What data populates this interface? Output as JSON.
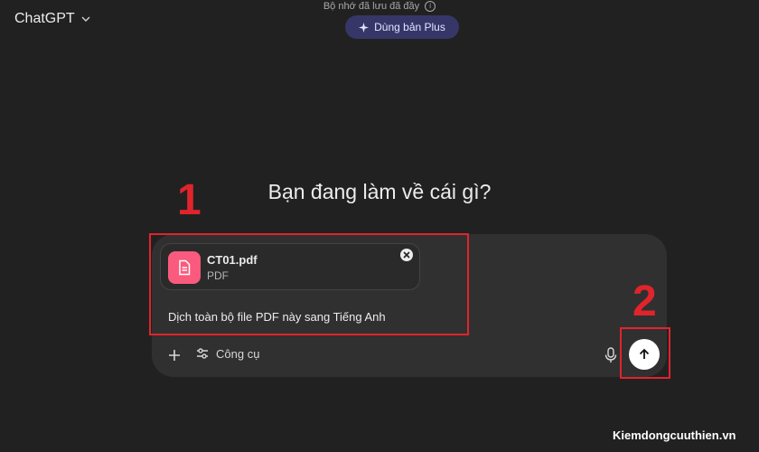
{
  "header": {
    "app_title": "ChatGPT",
    "memory_notice": "Bộ nhớ đã lưu đã đầy",
    "upgrade_label": "Dùng bản Plus"
  },
  "main": {
    "heading": "Bạn đang làm về cái gì?"
  },
  "composer": {
    "attachment": {
      "file_name": "CT01.pdf",
      "file_type": "PDF"
    },
    "prompt_text": "Dịch toàn bộ file PDF này sang Tiếng Anh",
    "tools_label": "Công cụ"
  },
  "annotations": {
    "label_1": "1",
    "label_2": "2"
  },
  "watermark": "Kiemdongcuuthien.vn",
  "colors": {
    "background": "#212121",
    "composer": "#303030",
    "plus_button": "#373669",
    "pdf_icon": "#fa5a7d",
    "annotation": "#e0242c"
  }
}
